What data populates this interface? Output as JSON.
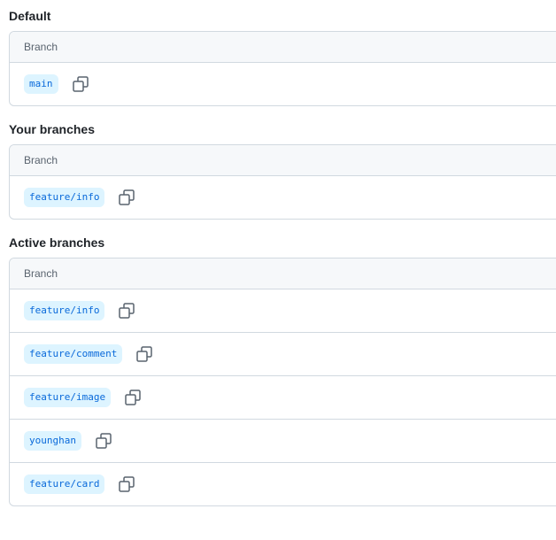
{
  "sections": {
    "default": {
      "title": "Default",
      "column_header": "Branch",
      "branches": [
        "main"
      ]
    },
    "yours": {
      "title": "Your branches",
      "column_header": "Branch",
      "branches": [
        "feature/info"
      ]
    },
    "active": {
      "title": "Active branches",
      "column_header": "Branch",
      "branches": [
        "feature/info",
        "feature/comment",
        "feature/image",
        "younghan",
        "feature/card"
      ]
    }
  },
  "icons": {
    "copy": "copy-icon"
  },
  "colors": {
    "pill_bg": "#ddf4ff",
    "pill_text": "#0969da",
    "border": "#d1d9e0",
    "header_bg": "#f6f8fa"
  }
}
